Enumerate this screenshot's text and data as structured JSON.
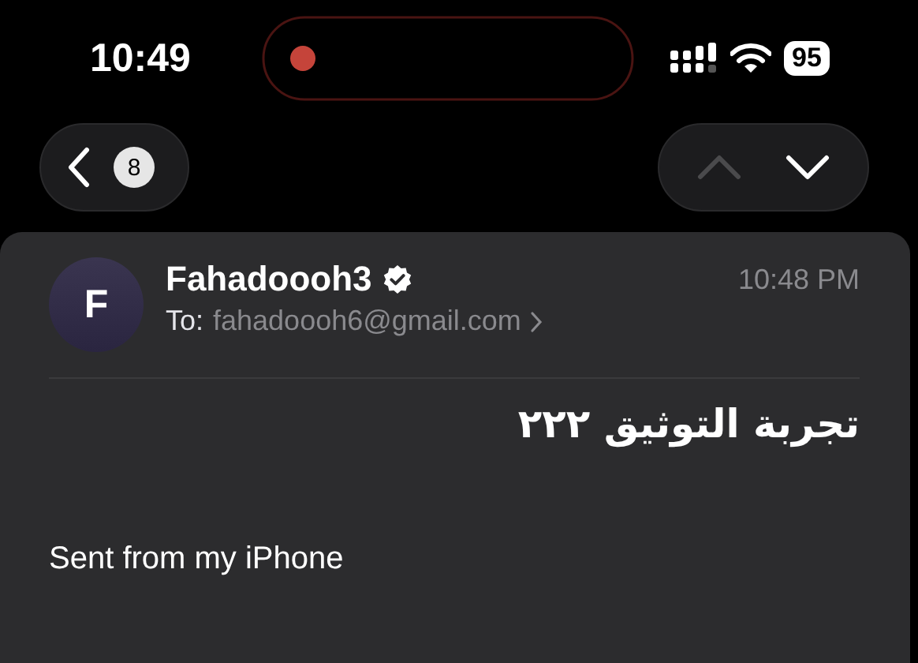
{
  "status_bar": {
    "time": "10:49",
    "battery": "95"
  },
  "navigation": {
    "count": "8",
    "previous_disabled": true,
    "next_disabled": false
  },
  "message": {
    "avatar_initial": "F",
    "sender": "Fahadoooh3",
    "verified": true,
    "to_label": "To:",
    "recipient": "fahadoooh6@gmail.com",
    "time": "10:48 PM",
    "subject": "تجربة التوثيق ٢٢٢",
    "body": "Sent from my iPhone"
  }
}
